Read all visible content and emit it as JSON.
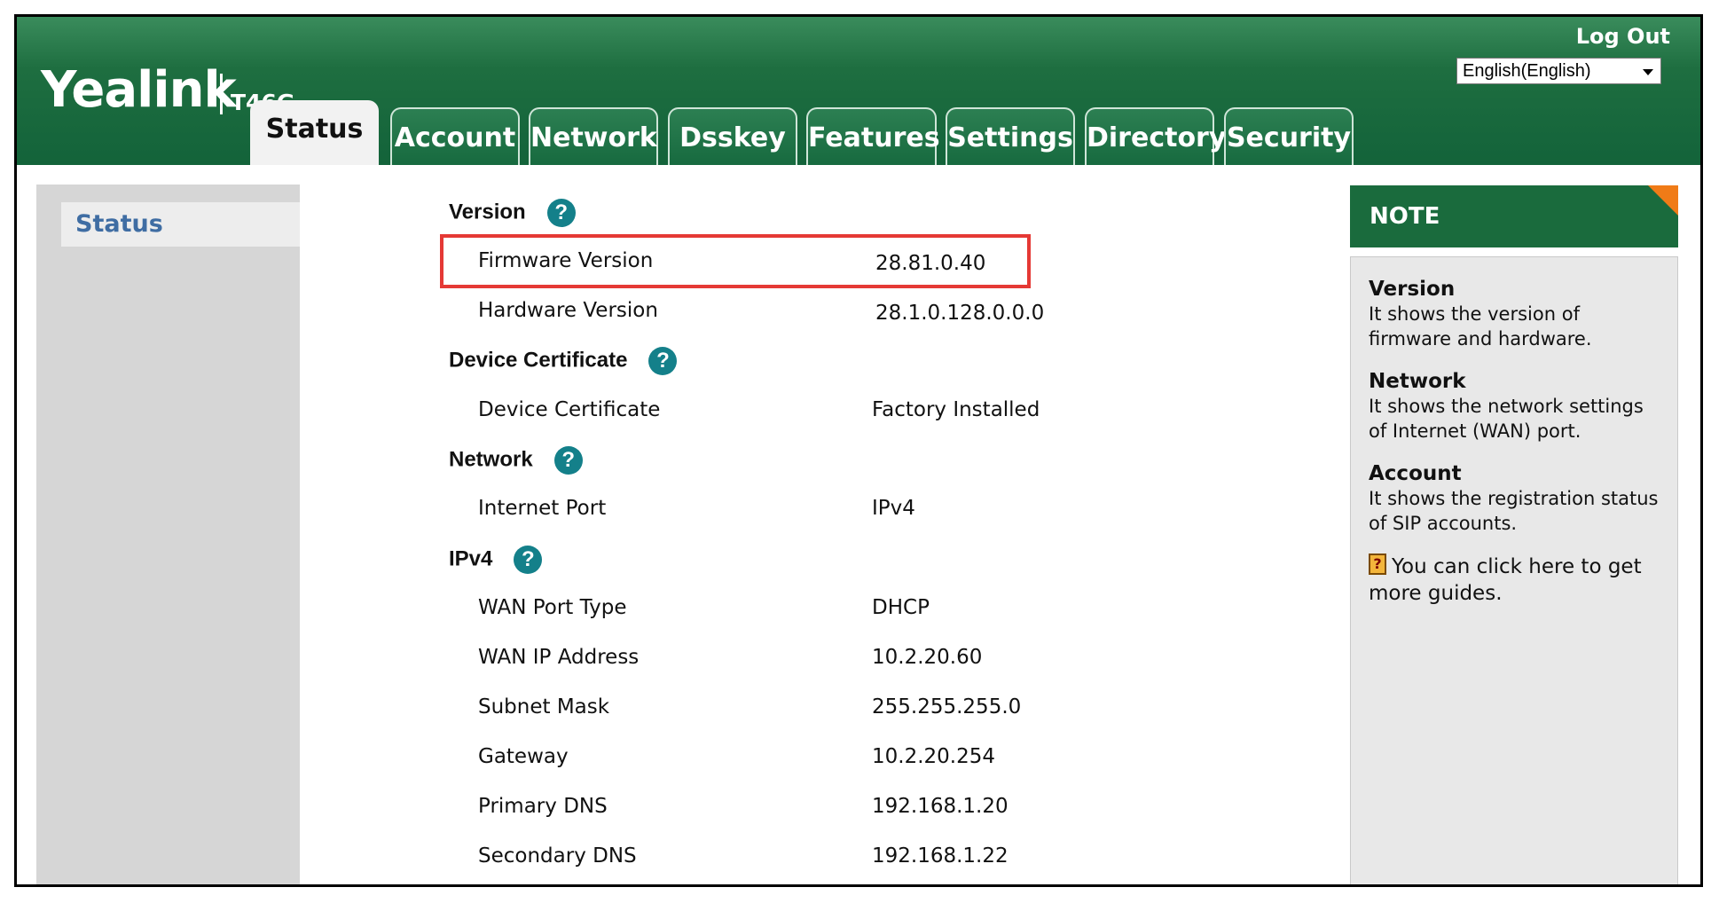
{
  "header": {
    "brand": "Yealink",
    "model": "T46G",
    "logout": "Log Out",
    "language": "English(English)"
  },
  "tabs": [
    {
      "label": "Status",
      "active": true
    },
    {
      "label": "Account",
      "active": false
    },
    {
      "label": "Network",
      "active": false
    },
    {
      "label": "Dsskey",
      "active": false
    },
    {
      "label": "Features",
      "active": false
    },
    {
      "label": "Settings",
      "active": false
    },
    {
      "label": "Directory",
      "active": false
    },
    {
      "label": "Security",
      "active": false
    }
  ],
  "sidebar": {
    "items": [
      {
        "label": "Status"
      }
    ]
  },
  "sections": {
    "version": {
      "title": "Version",
      "rows": [
        {
          "label": "Firmware Version",
          "value": "28.81.0.40"
        },
        {
          "label": "Hardware Version",
          "value": "28.1.0.128.0.0.0"
        }
      ]
    },
    "certificate": {
      "title": "Device Certificate",
      "rows": [
        {
          "label": "Device Certificate",
          "value": "Factory Installed"
        }
      ]
    },
    "network": {
      "title": "Network",
      "rows": [
        {
          "label": "Internet Port",
          "value": "IPv4"
        }
      ]
    },
    "ipv4": {
      "title": "IPv4",
      "rows": [
        {
          "label": "WAN Port Type",
          "value": "DHCP"
        },
        {
          "label": "WAN IP Address",
          "value": "10.2.20.60"
        },
        {
          "label": "Subnet Mask",
          "value": "255.255.255.0"
        },
        {
          "label": "Gateway",
          "value": "10.2.20.254"
        },
        {
          "label": "Primary DNS",
          "value": "192.168.1.20"
        },
        {
          "label": "Secondary DNS",
          "value": "192.168.1.22"
        }
      ]
    }
  },
  "note": {
    "title": "NOTE",
    "items": [
      {
        "title": "Version",
        "text": "It shows the version of firmware and hardware."
      },
      {
        "title": "Network",
        "text": "It shows the network settings of Internet (WAN) port."
      },
      {
        "title": "Account",
        "text": "It shows the registration status of SIP accounts."
      }
    ],
    "guide": "You can click here to get more guides."
  },
  "colors": {
    "header_green": "#1e6e40",
    "help_teal": "#14808a",
    "highlight_red": "#e53935",
    "note_accent": "#f07b17"
  },
  "icons": {
    "help": "question-mark-icon",
    "guide": "guide-book-icon",
    "dropdown": "chevron-down-icon"
  }
}
